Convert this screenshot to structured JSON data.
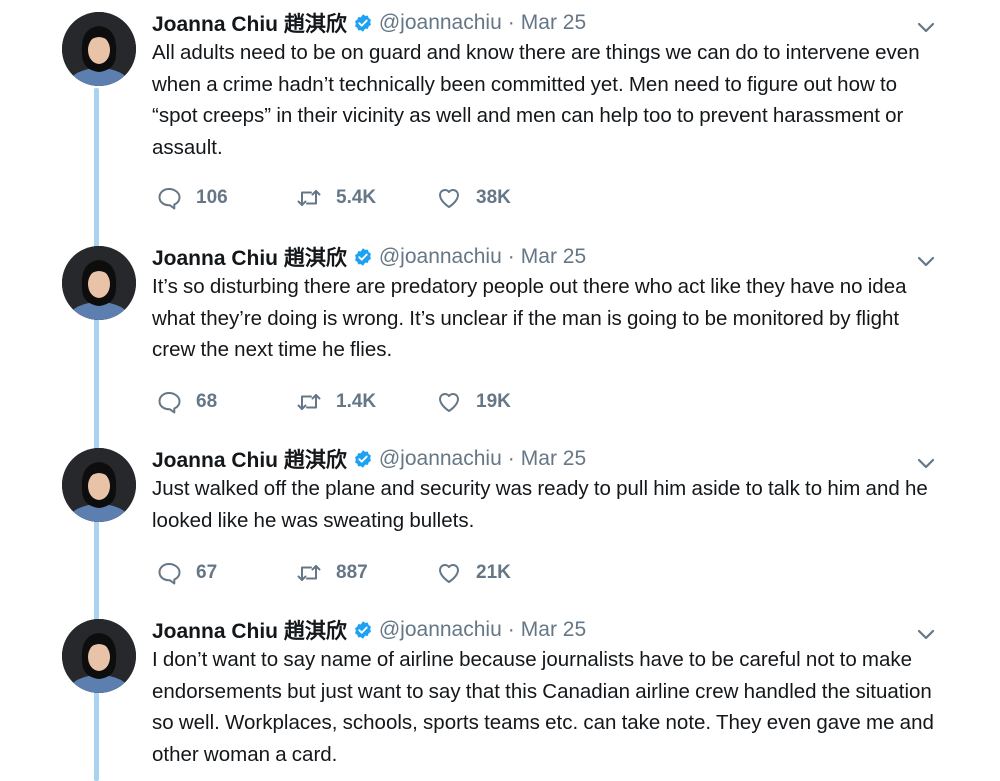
{
  "tweets": [
    {
      "author_name": "Joanna Chiu 趙淇欣",
      "handle": "@joannachiu",
      "separator": "·",
      "date": "Mar 25",
      "text": "All adults need to be on guard and know there are things we can do to intervene even when a crime hadn’t technically been committed yet. Men need to figure out how to “spot creeps” in their vicinity as well and men can help too to prevent harassment or assault.",
      "replies": "106",
      "retweets": "5.4K",
      "likes": "38K"
    },
    {
      "author_name": "Joanna Chiu 趙淇欣",
      "handle": "@joannachiu",
      "separator": "·",
      "date": "Mar 25",
      "text": "It’s so disturbing there are predatory people out there who act like they have no idea what they’re doing is wrong. It’s unclear if the man is going to be monitored by flight crew the next time he flies.",
      "replies": "68",
      "retweets": "1.4K",
      "likes": "19K"
    },
    {
      "author_name": "Joanna Chiu 趙淇欣",
      "handle": "@joannachiu",
      "separator": "·",
      "date": "Mar 25",
      "text": "Just walked off the plane and security was ready to pull him aside to talk to him and he looked like he was sweating bullets.",
      "replies": "67",
      "retweets": "887",
      "likes": "21K"
    },
    {
      "author_name": "Joanna Chiu 趙淇欣",
      "handle": "@joannachiu",
      "separator": "·",
      "date": "Mar 25",
      "text": "I don’t want to say name of airline because journalists have to be careful not to make endorsements but just want to say that this Canadian airline crew handled the situation so well. Workplaces, schools, sports teams etc. can take note. They even gave me and other woman a card."
    }
  ],
  "icons": {
    "reply": "reply-icon",
    "retweet": "retweet-icon",
    "like": "heart-icon",
    "verified": "verified-badge-icon",
    "caret": "chevron-down-icon"
  },
  "colors": {
    "thread_line": "#a8d3f2",
    "verified": "#1da1f2",
    "secondary_text": "#657786",
    "icon": "#657786"
  }
}
